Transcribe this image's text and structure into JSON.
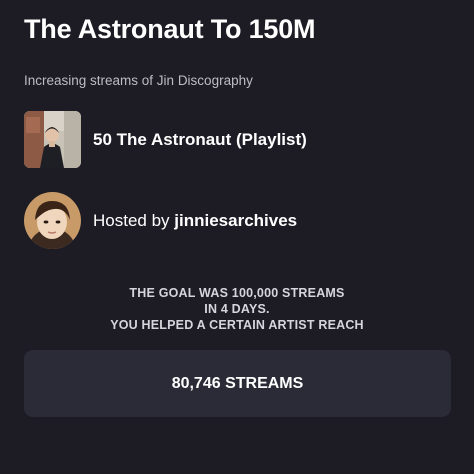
{
  "header": {
    "title": "The Astronaut To 150M",
    "subtitle": "Increasing streams of Jin Discography"
  },
  "playlist": {
    "label": "50 The Astronaut (Playlist)",
    "thumbnail_icon": "playlist-cover-photo"
  },
  "host": {
    "prefix": "Hosted by",
    "name": "jinniesarchives",
    "avatar_icon": "host-avatar-photo"
  },
  "goal": {
    "line1": "THE GOAL WAS 100,000 STREAMS",
    "line2": "IN 4 DAYS.",
    "line3": "YOU HELPED A CERTAIN ARTIST REACH"
  },
  "streams": {
    "label": "80,746 STREAMS"
  },
  "colors": {
    "background": "#1d1c25",
    "card": "#2a2b37",
    "text": "#ffffff",
    "muted_text": "#bdbcc4"
  }
}
